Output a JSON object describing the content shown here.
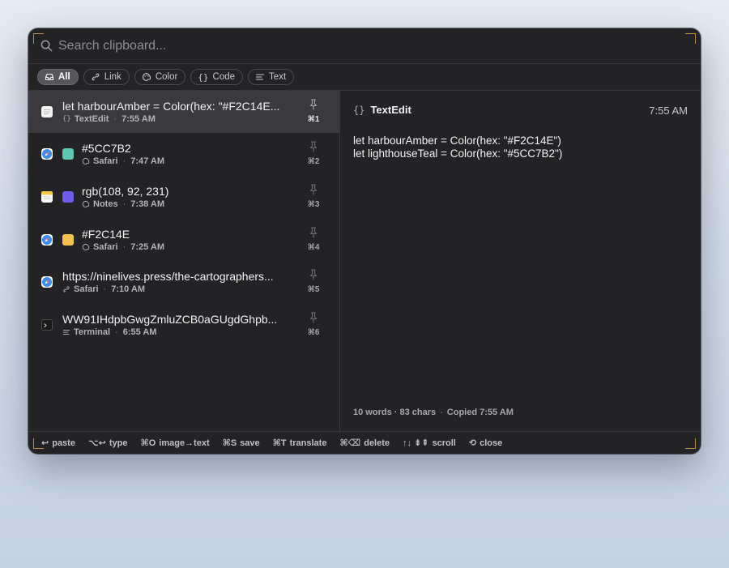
{
  "search": {
    "placeholder": "Search clipboard..."
  },
  "filters": [
    {
      "label": "All",
      "icon": "tray-icon",
      "active": true
    },
    {
      "label": "Link",
      "icon": "link-icon"
    },
    {
      "label": "Color",
      "icon": "palette-icon"
    },
    {
      "label": "Code",
      "icon": "braces-icon"
    },
    {
      "label": "Text",
      "icon": "text-lines-icon"
    }
  ],
  "items": [
    {
      "title": "let harbourAmber = Color(hex: \"#F2C14E...",
      "type_icon": "{}",
      "app": "TextEdit",
      "time": "7:55 AM",
      "shortcut": "⌘1"
    },
    {
      "title": "#5CC7B2",
      "app": "Safari",
      "time": "7:47 AM",
      "shortcut": "⌘2",
      "swatch": "#5CC7B2"
    },
    {
      "title": "rgb(108, 92, 231)",
      "app": "Notes",
      "time": "7:38 AM",
      "shortcut": "⌘3",
      "swatch": "#6C5CE7"
    },
    {
      "title": "#F2C14E",
      "app": "Safari",
      "time": "7:25 AM",
      "shortcut": "⌘4",
      "swatch": "#F2C14E"
    },
    {
      "title": "https://ninelives.press/the-cartographers...",
      "app": "Safari",
      "time": "7:10 AM",
      "shortcut": "⌘5"
    },
    {
      "title": "WW91IHdpbGwgZmluZCB0aGUgdGhpb...",
      "app": "Terminal",
      "time": "6:55 AM",
      "shortcut": "⌘6"
    }
  ],
  "preview": {
    "type_icon": "{}",
    "app": "TextEdit",
    "time": "7:55 AM",
    "lines": [
      "let harbourAmber = Color(hex: \"#F2C14E\")",
      "let lighthouseTeal = Color(hex: \"#5CC7B2\")"
    ],
    "stats": "10 words · 83 chars",
    "copied": "Copied 7:55 AM"
  },
  "footer": [
    {
      "key": "↩",
      "label": "paste"
    },
    {
      "key": "⌥↩",
      "label": "type"
    },
    {
      "key": "⌘O",
      "label": "image→text"
    },
    {
      "key": "⌘S",
      "label": "save"
    },
    {
      "key": "⌘T",
      "label": "translate"
    },
    {
      "key": "⌘⌫",
      "label": "delete"
    },
    {
      "key": "↑↓ ⇟⇞",
      "label": "scroll"
    },
    {
      "key": "⟲",
      "label": "close"
    }
  ],
  "colors": {
    "panel": "#232326",
    "selected_row": "#3a3a3e",
    "accent_corner": "#b88a3c"
  }
}
